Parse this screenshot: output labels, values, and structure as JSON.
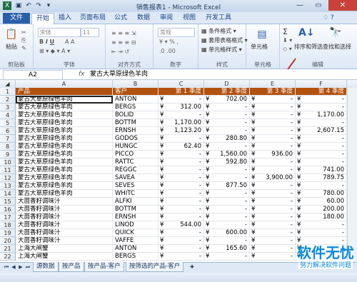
{
  "window": {
    "title": "销售报表1 - Microsoft Excel"
  },
  "ribbon_tabs": [
    "文件",
    "开始",
    "插入",
    "页面布局",
    "公式",
    "数据",
    "审阅",
    "视图",
    "开发工具"
  ],
  "ribbon": {
    "clipboard": {
      "label": "剪贴板",
      "paste": "粘贴"
    },
    "font": {
      "label": "字体",
      "font_name": "宋体",
      "font_size": "11"
    },
    "alignment": {
      "label": "对齐方式"
    },
    "number": {
      "label": "数字",
      "format": "常规"
    },
    "styles": {
      "label": "样式",
      "conditional": "条件格式",
      "table": "套用表格格式",
      "cell": "单元格样式"
    },
    "cells": {
      "label": "单元格",
      "name": "单元格"
    },
    "editing": {
      "label": "编辑",
      "sort_filter": "排序和筛选",
      "find_select": "查找和选择",
      "sum_symbol": "Σ"
    }
  },
  "formula_bar": {
    "name_box": "A2",
    "fx": "fx",
    "content": "蒙古大草原绿色羊肉"
  },
  "columns": [
    "A",
    "B",
    "C",
    "D",
    "E",
    "F"
  ],
  "header_row": [
    "产品",
    "客户",
    "第 1 季度",
    "第 2 季度",
    "第 3 季度",
    "第 4 季度"
  ],
  "rows": [
    {
      "n": "2",
      "a": "蒙古大草原绿色羊肉",
      "b": "ANTON",
      "c": "-",
      "d": "702.00",
      "e": "-",
      "f": "-"
    },
    {
      "n": "3",
      "a": "蒙古大草原绿色羊肉",
      "b": "BERGS",
      "c": "312.00",
      "d": "-",
      "e": "-",
      "f": "-"
    },
    {
      "n": "4",
      "a": "蒙古大草原绿色羊肉",
      "b": "BOLID",
      "c": "-",
      "d": "-",
      "e": "-",
      "f": "1,170.00"
    },
    {
      "n": "5",
      "a": "蒙古大草原绿色羊肉",
      "b": "BOTTM",
      "c": "1,170.00",
      "d": "-",
      "e": "-",
      "f": "-"
    },
    {
      "n": "6",
      "a": "蒙古大草原绿色羊肉",
      "b": "ERNSH",
      "c": "1,123.20",
      "d": "-",
      "e": "-",
      "f": "2,607.15"
    },
    {
      "n": "7",
      "a": "蒙古大草原绿色羊肉",
      "b": "GODOS",
      "c": "-",
      "d": "280.80",
      "e": "-",
      "f": "-"
    },
    {
      "n": "8",
      "a": "蒙古大草原绿色羊肉",
      "b": "HUNGC",
      "c": "62.40",
      "d": "-",
      "e": "-",
      "f": "-"
    },
    {
      "n": "9",
      "a": "蒙古大草原绿色羊肉",
      "b": "PICCO",
      "c": "-",
      "d": "1,560.00",
      "e": "936.00",
      "f": "-"
    },
    {
      "n": "10",
      "a": "蒙古大草原绿色羊肉",
      "b": "RATTC",
      "c": "-",
      "d": "592.80",
      "e": "-",
      "f": "-"
    },
    {
      "n": "11",
      "a": "蒙古大草原绿色羊肉",
      "b": "REGGC",
      "c": "-",
      "d": "-",
      "e": "-",
      "f": "741.00"
    },
    {
      "n": "12",
      "a": "蒙古大草原绿色羊肉",
      "b": "SAVEA",
      "c": "-",
      "d": "-",
      "e": "3,900.00",
      "f": "789.75"
    },
    {
      "n": "13",
      "a": "蒙古大草原绿色羊肉",
      "b": "SEVES",
      "c": "-",
      "d": "877.50",
      "e": "-",
      "f": "-"
    },
    {
      "n": "14",
      "a": "蒙古大草原绿色羊肉",
      "b": "WHITC",
      "c": "-",
      "d": "-",
      "e": "-",
      "f": "780.00"
    },
    {
      "n": "15",
      "a": "大茴香籽调味汁",
      "b": "ALFKI",
      "c": "-",
      "d": "-",
      "e": "-",
      "f": "60.00"
    },
    {
      "n": "16",
      "a": "大茴香籽调味汁",
      "b": "BOTTM",
      "c": "-",
      "d": "-",
      "e": "-",
      "f": "200.00"
    },
    {
      "n": "17",
      "a": "大茴香籽调味汁",
      "b": "ERNSH",
      "c": "-",
      "d": "-",
      "e": "-",
      "f": "180.00"
    },
    {
      "n": "18",
      "a": "大茴香籽调味汁",
      "b": "LINOD",
      "c": "544.00",
      "d": "-",
      "e": "-",
      "f": "-"
    },
    {
      "n": "19",
      "a": "大茴香籽调味汁",
      "b": "QUICK",
      "c": "-",
      "d": "600.00",
      "e": "-",
      "f": "-"
    },
    {
      "n": "20",
      "a": "大茴香籽调味汁",
      "b": "VAFFE",
      "c": "-",
      "d": "-",
      "e": "-",
      "f": "-"
    },
    {
      "n": "21",
      "a": "上海大闸蟹",
      "b": "ANTON",
      "c": "-",
      "d": "165.60",
      "e": "-",
      "f": "-"
    },
    {
      "n": "22",
      "a": "上海大闸蟹",
      "b": "BERGS",
      "c": "-",
      "d": "-",
      "e": "-",
      "f": "-"
    }
  ],
  "currency_symbol": "¥",
  "sheet_tabs": [
    "源数据",
    "按产品",
    "按产品-客户",
    "按筛选的产品-客户"
  ],
  "watermark": {
    "line1": "软件无忧",
    "line2": "努力解决软件问题"
  },
  "colors": {
    "header_fill": "#b2520f",
    "arrow": "#c0392b",
    "file_tab": "#2a5ea8"
  }
}
